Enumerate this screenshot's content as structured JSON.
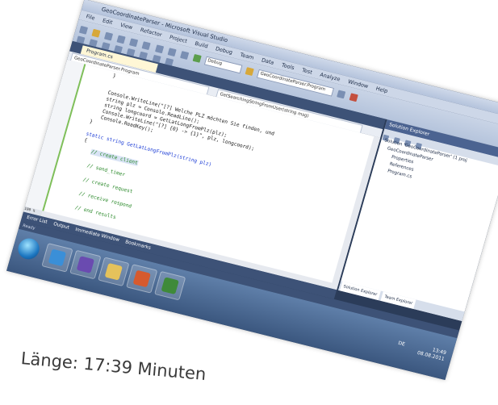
{
  "window": {
    "title": "GeoCoordinateParser - Microsoft Visual Studio"
  },
  "menu": [
    "File",
    "Edit",
    "View",
    "Refactor",
    "Project",
    "Build",
    "Debug",
    "Team",
    "Data",
    "Tools",
    "Test",
    "Analyze",
    "Window",
    "Help"
  ],
  "toolbar": {
    "config": "Debug",
    "search": "GeoCoordinateParser.Program"
  },
  "doc_tab": "Program.cs",
  "nav": {
    "left": "GeoCoordinateParser.Program",
    "right": "GetSearchingStringFromUser(string msg)"
  },
  "code": [
    "}",
    "Console.WriteLine(\"[?] Welche PLZ möchten Sie finden, und ",
    "string plz = Console.ReadLine();",
    "string longcoord = GetLatLongFromPlz(plz);",
    "Console.WriteLine(\"[?] {0} -> {1}\", plz, longcoord);",
    "Console.ReadKey();",
    "}",
    "static string GetLatLongFromPlz(string plz)",
    "{",
    "// create client",
    "// send_timer",
    "// create request",
    "// receive respond",
    "// end results"
  ],
  "solution": {
    "header": "Solution Explorer",
    "items": [
      "Solution 'GeoCoordinateParser' (1 proj",
      "GeoCoordinateParser",
      "Properties",
      "References",
      "Program.cs"
    ],
    "footer_tabs": [
      "Solution Explorer",
      "Team Explorer"
    ]
  },
  "bottom_tabs": [
    "Error List",
    "Output",
    "Immediate Window",
    "Bookmarks"
  ],
  "status": "Ready",
  "zoom": "100 %",
  "tray": {
    "lang": "DE",
    "time": "13:49",
    "date": "08.08.2011"
  },
  "caption": "Länge: 17:39 Minuten"
}
